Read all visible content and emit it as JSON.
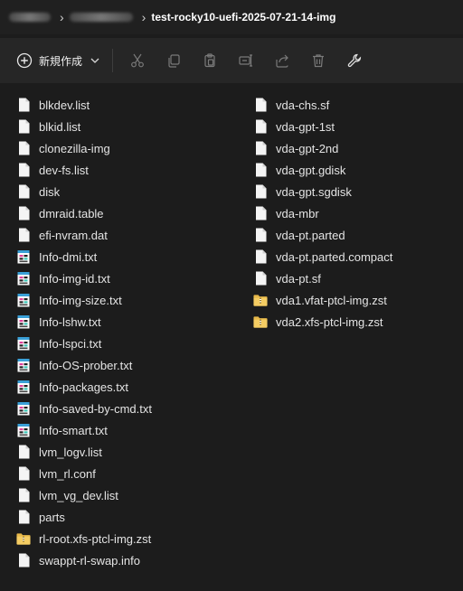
{
  "breadcrumb": {
    "current": "test-rocky10-uefi-2025-07-21-14-img"
  },
  "toolbar": {
    "new_label": "新規作成",
    "icons": [
      "cut-icon",
      "copy-icon",
      "paste-icon",
      "rename-icon",
      "share-icon",
      "delete-icon",
      "properties-icon"
    ]
  },
  "files": {
    "column1": [
      {
        "name": "blkdev.list",
        "icon": "file"
      },
      {
        "name": "blkid.list",
        "icon": "file"
      },
      {
        "name": "clonezilla-img",
        "icon": "file"
      },
      {
        "name": "dev-fs.list",
        "icon": "file"
      },
      {
        "name": "disk",
        "icon": "file"
      },
      {
        "name": "dmraid.table",
        "icon": "file"
      },
      {
        "name": "efi-nvram.dat",
        "icon": "file"
      },
      {
        "name": "Info-dmi.txt",
        "icon": "text"
      },
      {
        "name": "Info-img-id.txt",
        "icon": "text"
      },
      {
        "name": "Info-img-size.txt",
        "icon": "text"
      },
      {
        "name": "Info-lshw.txt",
        "icon": "text"
      },
      {
        "name": "Info-lspci.txt",
        "icon": "text"
      },
      {
        "name": "Info-OS-prober.txt",
        "icon": "text"
      },
      {
        "name": "Info-packages.txt",
        "icon": "text"
      },
      {
        "name": "Info-saved-by-cmd.txt",
        "icon": "text"
      },
      {
        "name": "Info-smart.txt",
        "icon": "text"
      },
      {
        "name": "lvm_logv.list",
        "icon": "file"
      },
      {
        "name": "lvm_rl.conf",
        "icon": "file"
      },
      {
        "name": "lvm_vg_dev.list",
        "icon": "file"
      },
      {
        "name": "parts",
        "icon": "file"
      },
      {
        "name": "rl-root.xfs-ptcl-img.zst",
        "icon": "archive"
      },
      {
        "name": "swappt-rl-swap.info",
        "icon": "file"
      }
    ],
    "column2": [
      {
        "name": "vda-chs.sf",
        "icon": "file"
      },
      {
        "name": "vda-gpt-1st",
        "icon": "file"
      },
      {
        "name": "vda-gpt-2nd",
        "icon": "file"
      },
      {
        "name": "vda-gpt.gdisk",
        "icon": "file"
      },
      {
        "name": "vda-gpt.sgdisk",
        "icon": "file"
      },
      {
        "name": "vda-mbr",
        "icon": "file"
      },
      {
        "name": "vda-pt.parted",
        "icon": "file"
      },
      {
        "name": "vda-pt.parted.compact",
        "icon": "file"
      },
      {
        "name": "vda-pt.sf",
        "icon": "file"
      },
      {
        "name": "vda1.vfat-ptcl-img.zst",
        "icon": "archive"
      },
      {
        "name": "vda2.xfs-ptcl-img.zst",
        "icon": "archive"
      }
    ]
  },
  "colors": {
    "background": "#1c1c1c",
    "toolbar": "#262626",
    "text": "#e4e4e4",
    "folder_zip": "#e8b94a"
  }
}
